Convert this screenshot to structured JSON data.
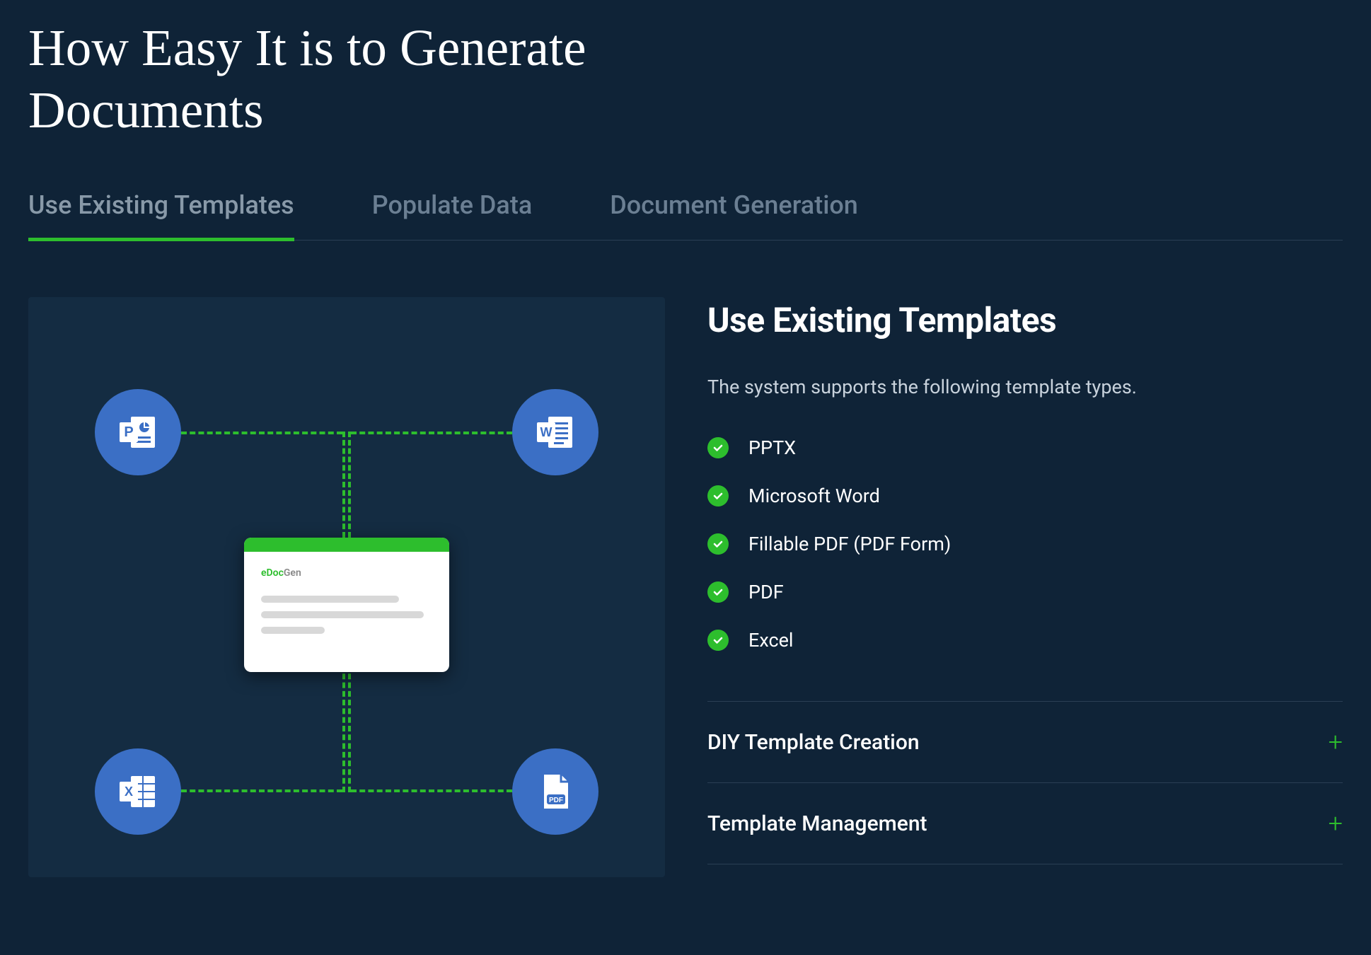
{
  "hero": {
    "heading": "How Easy It is to Generate Documents"
  },
  "tabs": [
    {
      "label": "Use Existing Templates",
      "active": true
    },
    {
      "label": "Populate Data",
      "active": false
    },
    {
      "label": "Document Generation",
      "active": false
    }
  ],
  "illustration": {
    "brand_prefix": "eDoc",
    "brand_suffix": "Gen",
    "nodes": [
      "powerpoint",
      "word",
      "excel",
      "pdf"
    ]
  },
  "panel": {
    "title": "Use Existing Templates",
    "description": "The system supports the following template types.",
    "items": [
      "PPTX",
      "Microsoft Word",
      "Fillable PDF (PDF Form)",
      "PDF",
      "Excel"
    ]
  },
  "accordion": [
    {
      "title": "DIY Template Creation"
    },
    {
      "title": "Template Management"
    }
  ]
}
